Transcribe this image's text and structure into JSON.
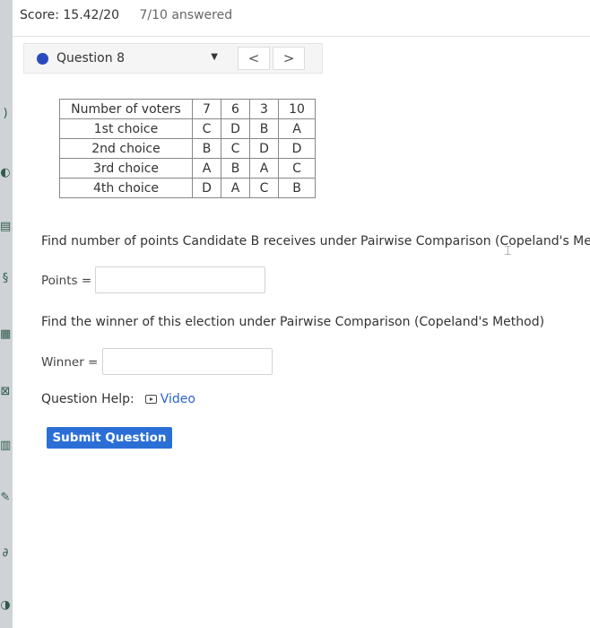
{
  "score_bar": {
    "score": "Score: 15.42/20",
    "answered": "7/10 answered"
  },
  "question_nav": {
    "label": "Question 8",
    "prev": "<",
    "next": ">"
  },
  "ballot_table": {
    "header_label": "Number of voters",
    "counts": [
      "7",
      "6",
      "3",
      "10"
    ],
    "rows": [
      {
        "label": "1st choice",
        "cells": [
          "C",
          "D",
          "B",
          "A"
        ]
      },
      {
        "label": "2nd choice",
        "cells": [
          "B",
          "C",
          "D",
          "D"
        ]
      },
      {
        "label": "3rd choice",
        "cells": [
          "A",
          "B",
          "A",
          "C"
        ]
      },
      {
        "label": "4th choice",
        "cells": [
          "D",
          "A",
          "C",
          "B"
        ]
      }
    ]
  },
  "q1": {
    "prompt": "Find number of points Candidate B receives under Pairwise Comparison (Copeland's Met",
    "label": "Points =",
    "value": ""
  },
  "q2": {
    "prompt": "Find the winner of this election under Pairwise Comparison (Copeland's Method)",
    "label": "Winner =",
    "value": ""
  },
  "help": {
    "label": "Question Help:",
    "video": "Video"
  },
  "submit_label": "Submit Question"
}
